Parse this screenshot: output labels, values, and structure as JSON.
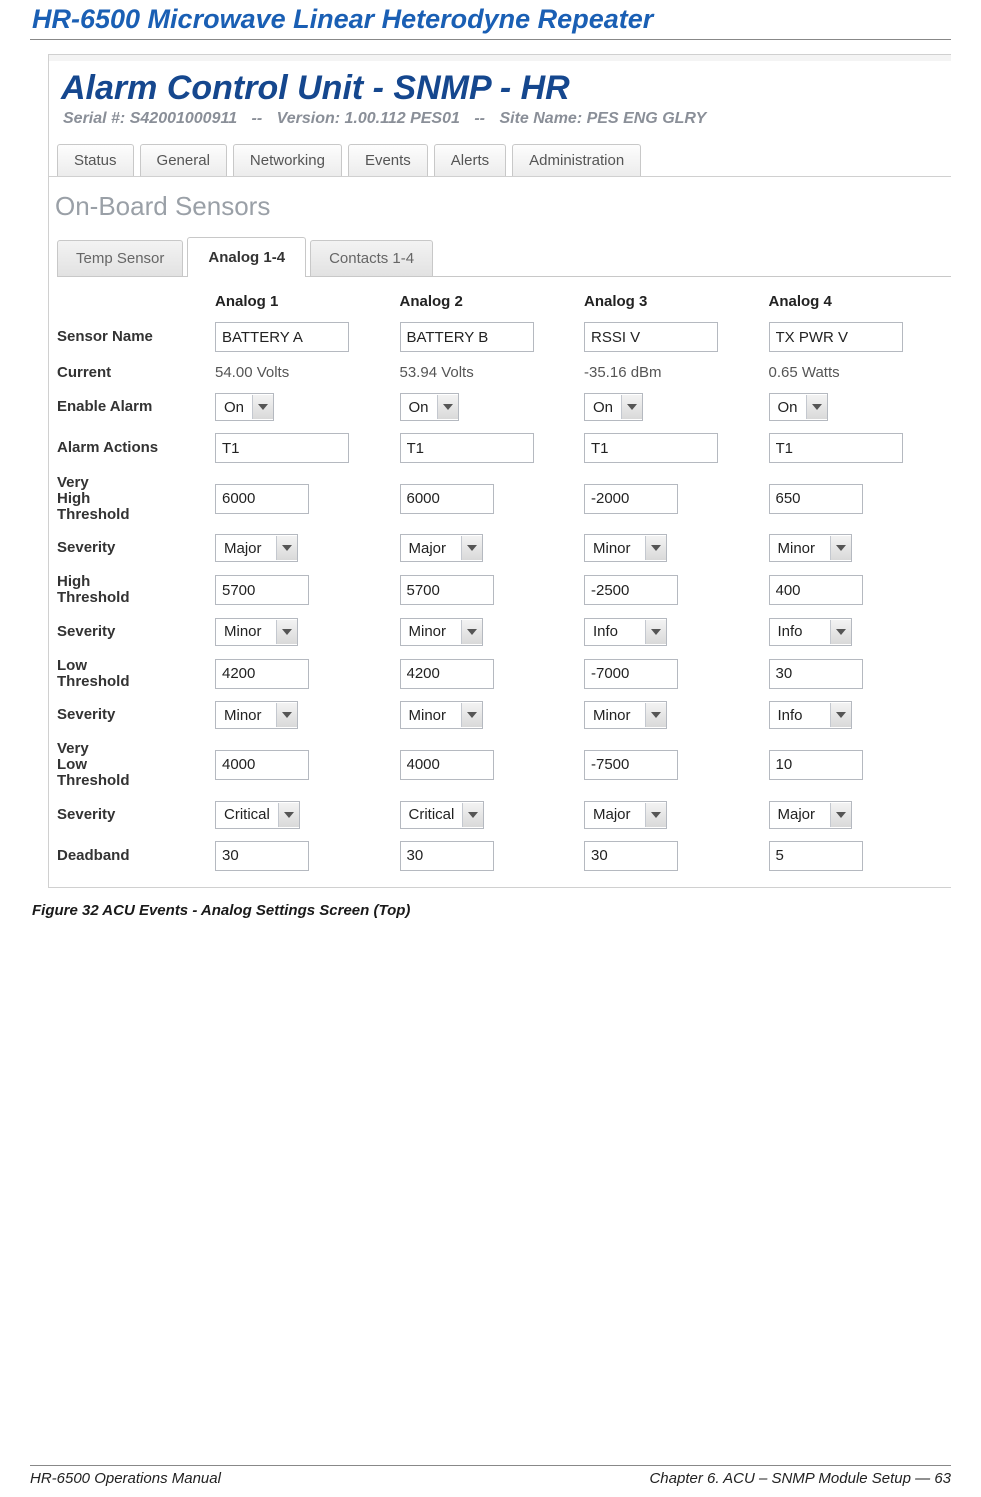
{
  "doc": {
    "title": "HR-6500 Microwave Linear Heterodyne Repeater",
    "caption": "Figure 32  ACU Events - Analog Settings Screen (Top)",
    "footer_left": "HR-6500 Operations Manual",
    "footer_right": "Chapter 6. ACU – SNMP Module Setup — 63"
  },
  "app": {
    "title": "Alarm Control Unit - SNMP - HR",
    "serial_label": "Serial #:",
    "serial": "S42001000911",
    "version_label": "Version:",
    "version": "1.00.112 PES01",
    "site_label": "Site Name:",
    "site": "PES ENG GLRY",
    "sep": "--"
  },
  "tabs_main": [
    "Status",
    "General",
    "Networking",
    "Events",
    "Alerts",
    "Administration"
  ],
  "section_header": "On-Board Sensors",
  "subtabs": [
    "Temp Sensor",
    "Analog 1-4",
    "Contacts 1-4"
  ],
  "subtab_active": "Analog 1-4",
  "cols": [
    "Analog 1",
    "Analog 2",
    "Analog 3",
    "Analog 4"
  ],
  "rows": {
    "sensor_name": {
      "label": "Sensor Name",
      "type": "text",
      "v": [
        "BATTERY A",
        "BATTERY B",
        "RSSI V",
        "TX PWR V"
      ]
    },
    "current": {
      "label": "Current",
      "type": "read",
      "v": [
        "54.00 Volts",
        "53.94 Volts",
        "-35.16 dBm",
        "0.65 Watts"
      ]
    },
    "enable_alarm": {
      "label": "Enable Alarm",
      "type": "selsm",
      "v": [
        "On",
        "On",
        "On",
        "On"
      ]
    },
    "alarm_actions": {
      "label": "Alarm Actions",
      "type": "text",
      "v": [
        "T1",
        "T1",
        "T1",
        "T1"
      ]
    },
    "very_high": {
      "label": "Very High Threshold",
      "type": "num",
      "v": [
        "6000",
        "6000",
        "-2000",
        "650"
      ]
    },
    "sev_vh": {
      "label": "Severity",
      "type": "sel",
      "v": [
        "Major",
        "Major",
        "Minor",
        "Minor"
      ]
    },
    "high": {
      "label": "High Threshold",
      "type": "num",
      "v": [
        "5700",
        "5700",
        "-2500",
        "400"
      ]
    },
    "sev_h": {
      "label": "Severity",
      "type": "sel",
      "v": [
        "Minor",
        "Minor",
        "Info",
        "Info"
      ]
    },
    "low": {
      "label": "Low Threshold",
      "type": "num",
      "v": [
        "4200",
        "4200",
        "-7000",
        "30"
      ]
    },
    "sev_l": {
      "label": "Severity",
      "type": "sel",
      "v": [
        "Minor",
        "Minor",
        "Minor",
        "Info"
      ]
    },
    "very_low": {
      "label": "Very Low Threshold",
      "type": "num",
      "v": [
        "4000",
        "4000",
        "-7500",
        "10"
      ]
    },
    "sev_vl": {
      "label": "Severity",
      "type": "sel",
      "v": [
        "Critical",
        "Critical",
        "Major",
        "Major"
      ]
    },
    "deadband": {
      "label": "Deadband",
      "type": "num",
      "v": [
        "30",
        "30",
        "30",
        "5"
      ]
    }
  },
  "row_order": [
    "sensor_name",
    "current",
    "enable_alarm",
    "alarm_actions",
    "very_high",
    "sev_vh",
    "high",
    "sev_h",
    "low",
    "sev_l",
    "very_low",
    "sev_vl",
    "deadband"
  ]
}
